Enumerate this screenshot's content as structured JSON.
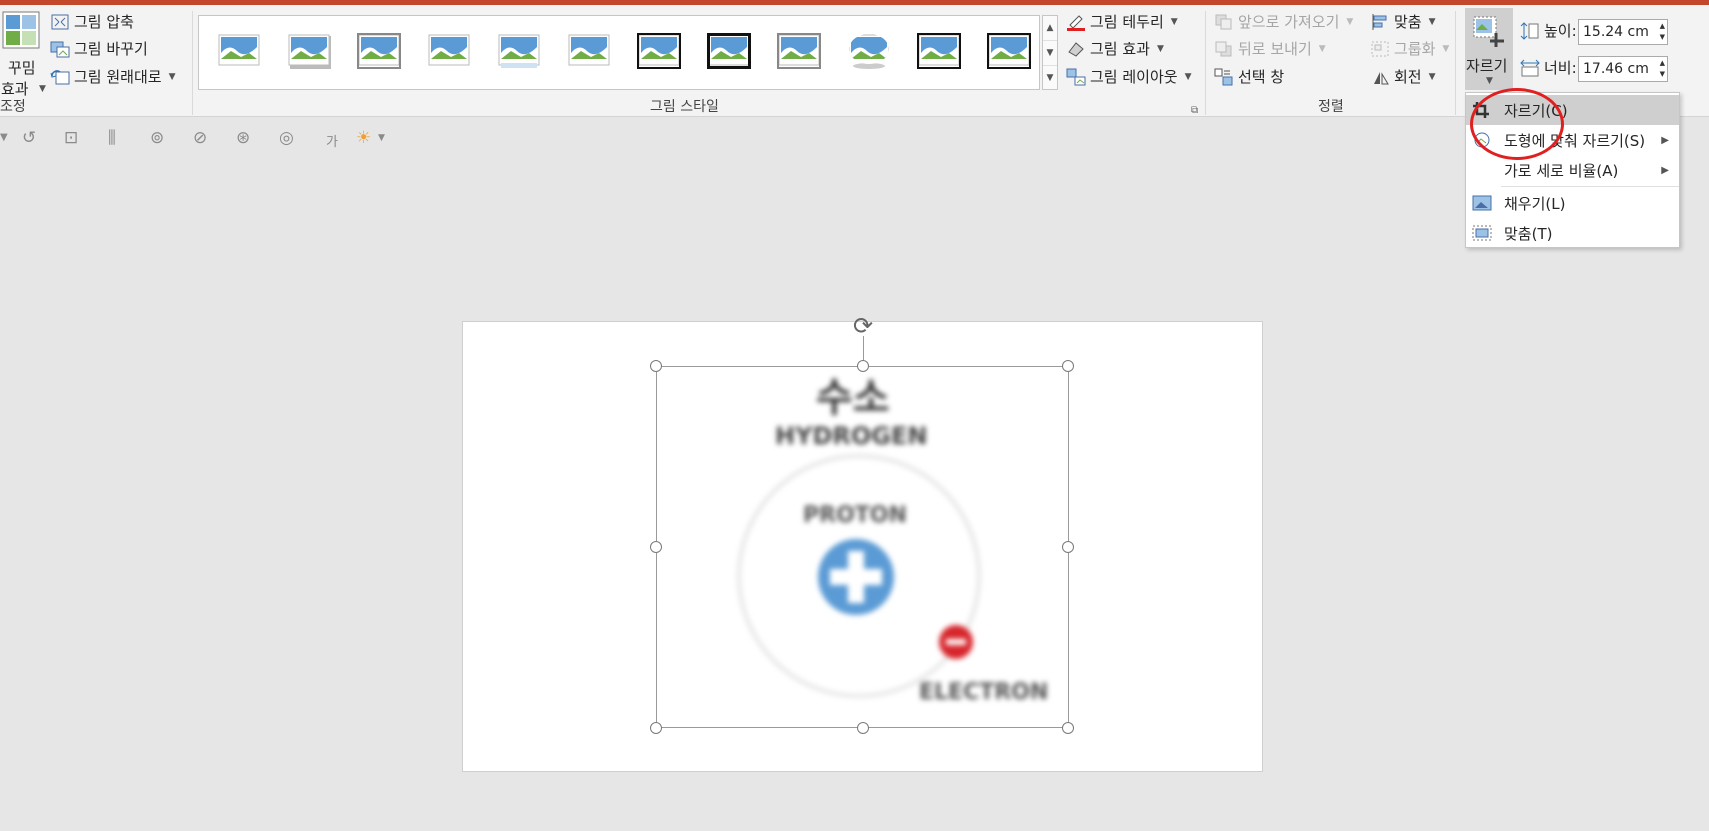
{
  "colors": {
    "accent": "#c2472b",
    "ribbon_bg": "#f3f3f3",
    "workspace_bg": "#e6e6e6",
    "highlight": "#cfcfcf",
    "annotation": "#e02020",
    "proton_blue": "#5b9bd5",
    "electron_red": "#d7262c"
  },
  "adjust_group": {
    "artistic_label_1": "꾸밈",
    "artistic_label_2": "효과",
    "compress": "그림 압축",
    "change": "그림 바꾸기",
    "reset": "그림 원래대로",
    "group_label": "조정"
  },
  "styles_group": {
    "group_label": "그림 스타일",
    "border": "그림 테두리",
    "effects": "그림 효과",
    "layout": "그림 레이아웃"
  },
  "arrange_group": {
    "group_label": "정렬",
    "bring_forward": "앞으로 가져오기",
    "send_backward": "뒤로 보내기",
    "selection_pane": "선택 창",
    "align": "맞춤",
    "group": "그룹화",
    "rotate": "회전"
  },
  "size_group": {
    "crop_button": "자르기",
    "height_label": "높이:",
    "height_value": "15.24 cm",
    "width_label": "너비:",
    "width_value": "17.46 cm"
  },
  "minibar": {
    "text_glyph": "가"
  },
  "slide": {
    "title_ko": "수소",
    "title_en": "HYDROGEN",
    "proton": "PROTON",
    "electron": "ELECTRON"
  },
  "crop_menu": {
    "items": [
      {
        "label": "자르기(C)",
        "icon": "crop-icon",
        "submenu": false,
        "highlighted": true
      },
      {
        "label": "도형에 맞춰 자르기(S)",
        "icon": "shape-crop-icon",
        "submenu": true
      },
      {
        "label": "가로 세로 비율(A)",
        "icon": "",
        "submenu": true
      },
      {
        "label": "채우기(L)",
        "icon": "fill-icon",
        "submenu": false
      },
      {
        "label": "맞춤(T)",
        "icon": "fit-icon",
        "submenu": false
      }
    ]
  }
}
